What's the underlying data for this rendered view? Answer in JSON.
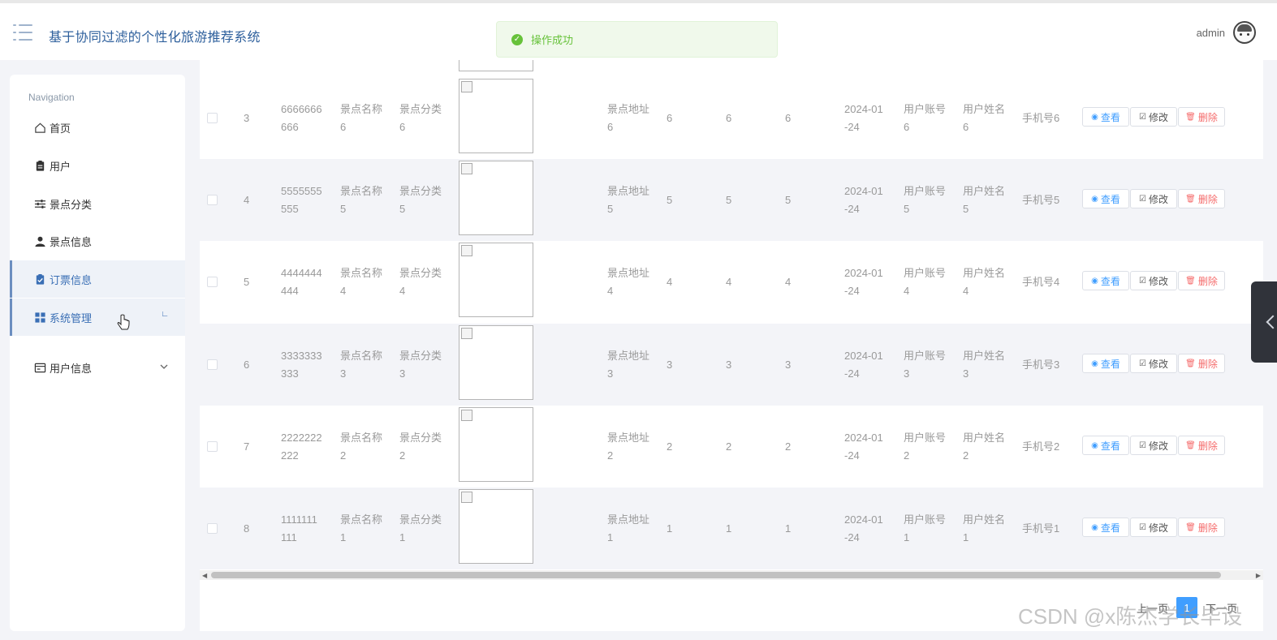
{
  "header": {
    "app_title": "基于协同过滤的个性化旅游推荐系统",
    "toast": "操作成功",
    "username": "admin"
  },
  "sidebar": {
    "heading": "Navigation",
    "items": [
      {
        "label": "首页",
        "icon": "home-icon"
      },
      {
        "label": "用户",
        "icon": "clipboard-icon"
      },
      {
        "label": "景点分类",
        "icon": "sliders-icon"
      },
      {
        "label": "景点信息",
        "icon": "person-icon"
      },
      {
        "label": "订票信息",
        "icon": "clipboard-check-icon",
        "active": true
      },
      {
        "label": "系统管理",
        "icon": "grid-icon",
        "active": true
      },
      {
        "label": "用户信息",
        "icon": "id-card-icon",
        "expandable": true
      }
    ]
  },
  "table": {
    "rows": [
      {
        "index": "3",
        "id_a": "6666666",
        "id_b": "666",
        "name_a": "景点名称",
        "name_b": "6",
        "cat_a": "景点分类",
        "cat_b": "6",
        "addr_a": "景点地址",
        "addr_b": "6",
        "v1": "6",
        "v2": "6",
        "v3": "6",
        "date_a": "2024-01",
        "date_b": "-24",
        "acct_a": "用户账号",
        "acct_b": "6",
        "uname_a": "用户姓名",
        "uname_b": "6",
        "phone": "手机号6"
      },
      {
        "index": "4",
        "id_a": "5555555",
        "id_b": "555",
        "name_a": "景点名称",
        "name_b": "5",
        "cat_a": "景点分类",
        "cat_b": "5",
        "addr_a": "景点地址",
        "addr_b": "5",
        "v1": "5",
        "v2": "5",
        "v3": "5",
        "date_a": "2024-01",
        "date_b": "-24",
        "acct_a": "用户账号",
        "acct_b": "5",
        "uname_a": "用户姓名",
        "uname_b": "5",
        "phone": "手机号5"
      },
      {
        "index": "5",
        "id_a": "4444444",
        "id_b": "444",
        "name_a": "景点名称",
        "name_b": "4",
        "cat_a": "景点分类",
        "cat_b": "4",
        "addr_a": "景点地址",
        "addr_b": "4",
        "v1": "4",
        "v2": "4",
        "v3": "4",
        "date_a": "2024-01",
        "date_b": "-24",
        "acct_a": "用户账号",
        "acct_b": "4",
        "uname_a": "用户姓名",
        "uname_b": "4",
        "phone": "手机号4"
      },
      {
        "index": "6",
        "id_a": "3333333",
        "id_b": "333",
        "name_a": "景点名称",
        "name_b": "3",
        "cat_a": "景点分类",
        "cat_b": "3",
        "addr_a": "景点地址",
        "addr_b": "3",
        "v1": "3",
        "v2": "3",
        "v3": "3",
        "date_a": "2024-01",
        "date_b": "-24",
        "acct_a": "用户账号",
        "acct_b": "3",
        "uname_a": "用户姓名",
        "uname_b": "3",
        "phone": "手机号3"
      },
      {
        "index": "7",
        "id_a": "2222222",
        "id_b": "222",
        "name_a": "景点名称",
        "name_b": "2",
        "cat_a": "景点分类",
        "cat_b": "2",
        "addr_a": "景点地址",
        "addr_b": "2",
        "v1": "2",
        "v2": "2",
        "v3": "2",
        "date_a": "2024-01",
        "date_b": "-24",
        "acct_a": "用户账号",
        "acct_b": "2",
        "uname_a": "用户姓名",
        "uname_b": "2",
        "phone": "手机号2"
      },
      {
        "index": "8",
        "id_a": "1111111",
        "id_b": "111",
        "name_a": "景点名称",
        "name_b": "1",
        "cat_a": "景点分类",
        "cat_b": "1",
        "addr_a": "景点地址",
        "addr_b": "1",
        "v1": "1",
        "v2": "1",
        "v3": "1",
        "date_a": "2024-01",
        "date_b": "-24",
        "acct_a": "用户账号",
        "acct_b": "1",
        "uname_a": "用户姓名",
        "uname_b": "1",
        "phone": "手机号1"
      }
    ],
    "actions": {
      "view": "查看",
      "edit": "修改",
      "delete": "删除"
    }
  },
  "pagination": {
    "prev": "上一页",
    "current": "1",
    "next": "下一页"
  },
  "watermark": "CSDN @x陈杰学长毕设",
  "colors": {
    "accent": "#409eff",
    "danger": "#f56c6c",
    "success": "#67c23a",
    "title": "#2d5f9c"
  }
}
